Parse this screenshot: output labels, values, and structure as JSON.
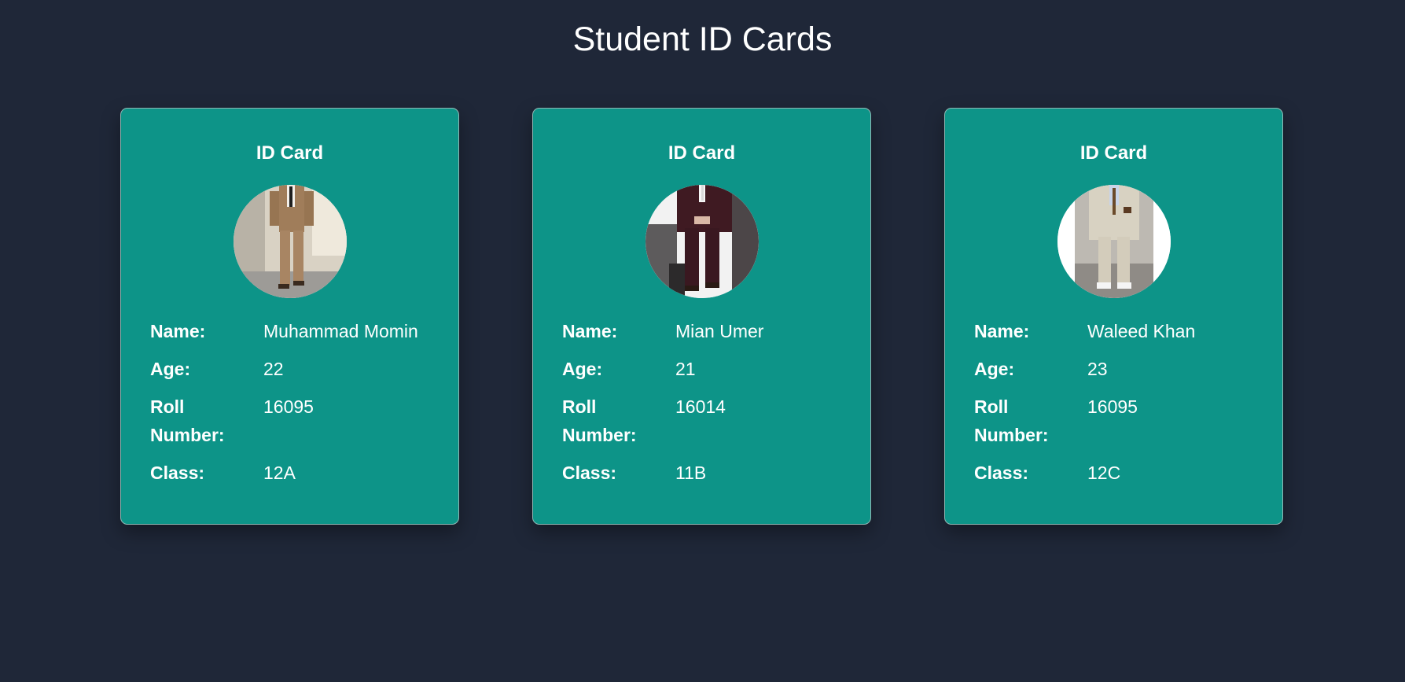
{
  "page": {
    "title": "Student ID Cards",
    "background_color": "#1f2738",
    "card_color": "#0d9488"
  },
  "cards": [
    {
      "title": "ID Card",
      "photo_icon": "student-photo",
      "labels": {
        "name": "Name:",
        "age": "Age:",
        "roll": "Roll Number:",
        "class": "Class:"
      },
      "name": "Muhammad Momin",
      "age": "22",
      "roll_number": "16095",
      "class": "12A"
    },
    {
      "title": "ID Card",
      "photo_icon": "student-photo",
      "labels": {
        "name": "Name:",
        "age": "Age:",
        "roll": "Roll Number:",
        "class": "Class:"
      },
      "name": "Mian Umer",
      "age": "21",
      "roll_number": "16014",
      "class": "11B"
    },
    {
      "title": "ID Card",
      "photo_icon": "student-photo",
      "labels": {
        "name": "Name:",
        "age": "Age:",
        "roll": "Roll Number:",
        "class": "Class:"
      },
      "name": "Waleed Khan",
      "age": "23",
      "roll_number": "16095",
      "class": "12C"
    }
  ]
}
